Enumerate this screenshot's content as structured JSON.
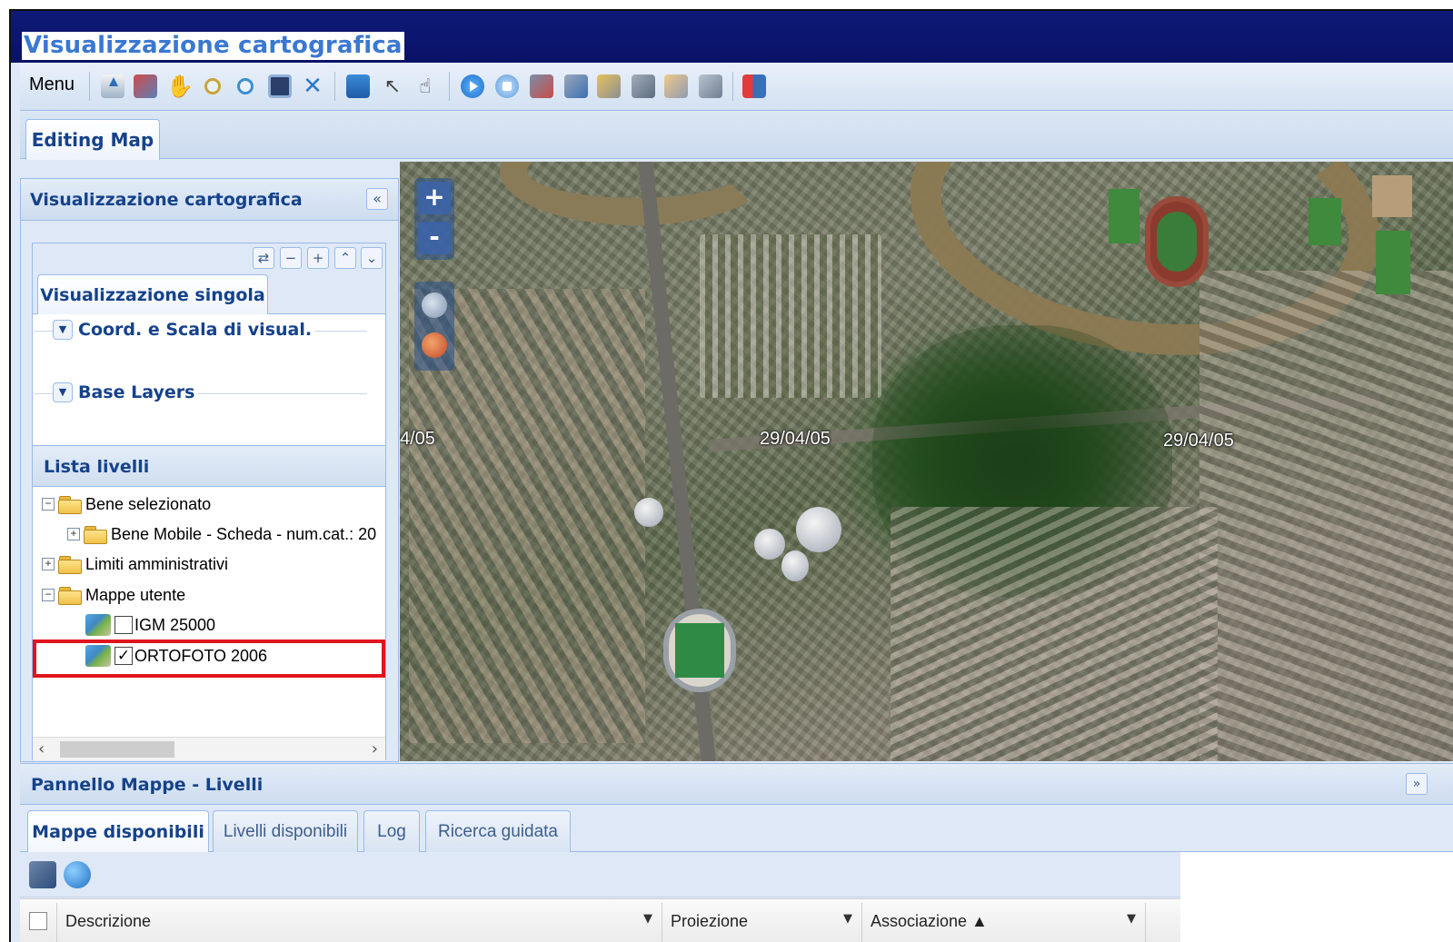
{
  "window": {
    "title": "Visualizzazione cartografica"
  },
  "toolbar": {
    "menu_label": "Menu",
    "icons": [
      "upload-icon",
      "book-icon",
      "pan-hand-icon",
      "zoom-in-icon",
      "zoom-out-icon",
      "zoom-box-icon",
      "full-extent-icon",
      "identify-icon",
      "select-pointer-icon",
      "info-pointer-icon",
      "play-icon",
      "stop-icon",
      "edit-icon",
      "grid-edit-icon",
      "note-icon",
      "copy-icon",
      "hand-point-icon",
      "edit-doc-icon",
      "exit-icon"
    ]
  },
  "main_tab": {
    "label": "Editing Map"
  },
  "left_panel": {
    "title": "Visualizzazione cartografica",
    "collapse_symbol": "«",
    "inner_tools": [
      "⇄",
      "−",
      "+",
      "⌃",
      "⌄"
    ],
    "tab_label": "Visualizzazione singola",
    "fieldsets": [
      {
        "label": "Coord. e Scala di visual."
      },
      {
        "label": "Base Layers"
      }
    ],
    "list_title": "Lista livelli",
    "tree": [
      {
        "label": "Bene selezionato",
        "toggle": "−"
      },
      {
        "label": "Bene Mobile - Scheda - num.cat.: 20",
        "toggle": "+"
      },
      {
        "label": "Limiti amministrativi",
        "toggle": "+"
      },
      {
        "label": "Mappe utente",
        "toggle": "−"
      },
      {
        "label": "IGM 25000",
        "checked": ""
      },
      {
        "label": "ORTOFOTO 2006",
        "checked": "✓"
      }
    ],
    "scroll_left": "‹",
    "scroll_right": "›"
  },
  "map": {
    "zoom_in": "+",
    "zoom_out": "-",
    "date_labels": [
      "4/05",
      "29/04/05",
      "29/04/05"
    ]
  },
  "bottom_panel": {
    "title": "Pannello Mappe - Livelli",
    "collapse_symbol": "»",
    "tabs": [
      {
        "label": "Mappe disponibili"
      },
      {
        "label": "Livelli disponibili"
      },
      {
        "label": "Log"
      },
      {
        "label": "Ricerca guidata"
      }
    ],
    "columns": [
      {
        "label": "Descrizione"
      },
      {
        "label": "Proiezione"
      },
      {
        "label": "Associazione ▲"
      }
    ],
    "dropdown_symbol": "▼"
  },
  "colors": {
    "highlight": "#e0141d",
    "title_bar": "#0e1a78",
    "panel_text": "#15428b"
  }
}
